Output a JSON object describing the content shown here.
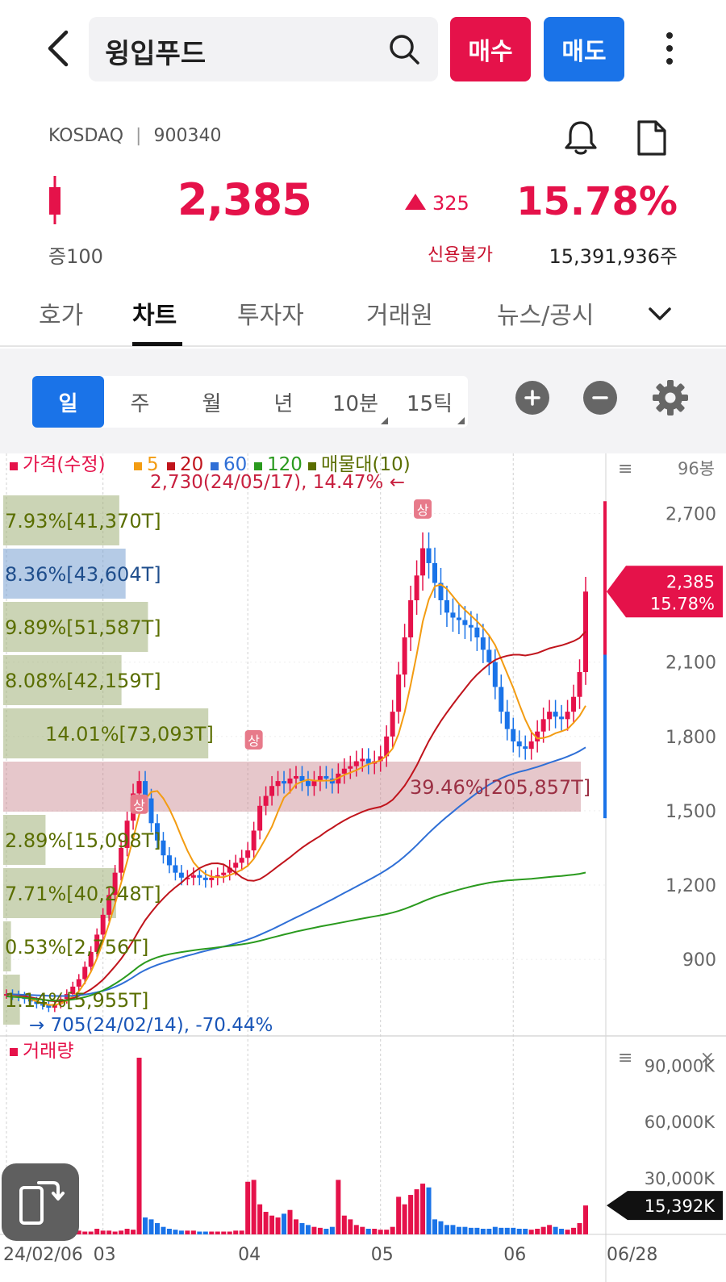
{
  "header": {
    "stock_name": "윙입푸드",
    "buy_label": "매수",
    "sell_label": "매도"
  },
  "info": {
    "market": "KOSDAQ",
    "code": "900340",
    "price": "2,385",
    "change": "325",
    "change_pct": "15.78%",
    "board": "증100",
    "credit": "신용불가",
    "shares": "15,391,936주"
  },
  "tabs": [
    {
      "label": "호가",
      "active": false
    },
    {
      "label": "차트",
      "active": true
    },
    {
      "label": "투자자",
      "active": false
    },
    {
      "label": "거래원",
      "active": false
    },
    {
      "label": "뉴스/공시",
      "active": false
    }
  ],
  "periods": [
    {
      "label": "일",
      "active": true
    },
    {
      "label": "주",
      "active": false
    },
    {
      "label": "월",
      "active": false
    },
    {
      "label": "년",
      "active": false
    },
    {
      "label": "10분",
      "active": false
    },
    {
      "label": "15틱",
      "active": false
    }
  ],
  "colors": {
    "up": "#e5124a",
    "down": "#1a73e8",
    "ma5": "#f39c12",
    "ma20": "#c0141c",
    "ma60": "#2f6fd6",
    "ma120": "#2a9a1e",
    "profile": "#5a6e00"
  },
  "chart_data": [
    {
      "type": "candlestick",
      "legend": [
        {
          "label": "가격(수정)",
          "color": "#e5124a"
        },
        {
          "label": "5",
          "color": "#f39c12"
        },
        {
          "label": "20",
          "color": "#c0141c"
        },
        {
          "label": "60",
          "color": "#2f6fd6"
        },
        {
          "label": "120",
          "color": "#2a9a1e"
        },
        {
          "label": "매물대(10)",
          "color": "#5a6e00"
        }
      ],
      "bar_count_label": "96봉",
      "y_ticks": [
        2700,
        2100,
        1800,
        1500,
        1200,
        900
      ],
      "y_tick_labels": [
        "2,700",
        "2,100",
        "1,800",
        "1,500",
        "1,200",
        "900"
      ],
      "ylim": [
        630,
        2780
      ],
      "x_labels": [
        "24/02/06",
        "03",
        "04",
        "05",
        "06",
        "06/28"
      ],
      "high_annotation": "2,730(24/05/17), 14.47%",
      "low_annotation": "705(24/02/14), -70.44%",
      "current_price_label": "2,385",
      "current_pct_label": "15.78%",
      "upper_limit_badge": "상",
      "volume_profile": [
        {
          "label": "7.93%[41,370T]",
          "pct": 7.93
        },
        {
          "label": "8.36%[43,604T]",
          "pct": 8.36
        },
        {
          "label": "9.89%[51,587T]",
          "pct": 9.89
        },
        {
          "label": "8.08%[42,159T]",
          "pct": 8.08
        },
        {
          "label": "14.01%[73,093T]",
          "pct": 14.01
        },
        {
          "label": "39.46%[205,857T]",
          "pct": 39.46
        },
        {
          "label": "2.89%[15,098T]",
          "pct": 2.89
        },
        {
          "label": "7.71%[40,248T]",
          "pct": 7.71
        },
        {
          "label": "0.53%[2,756T]",
          "pct": 0.53
        },
        {
          "label": "1.14%[5,955T]",
          "pct": 1.14
        }
      ],
      "closes": [
        760,
        755,
        750,
        740,
        730,
        720,
        715,
        705,
        720,
        740,
        760,
        790,
        820,
        870,
        930,
        1000,
        1080,
        1160,
        1250,
        1350,
        1460,
        1570,
        1620,
        1550,
        1450,
        1380,
        1320,
        1280,
        1250,
        1230,
        1230,
        1240,
        1230,
        1220,
        1230,
        1240,
        1250,
        1270,
        1290,
        1310,
        1340,
        1420,
        1520,
        1560,
        1600,
        1620,
        1610,
        1630,
        1640,
        1620,
        1600,
        1620,
        1640,
        1630,
        1610,
        1650,
        1670,
        1680,
        1700,
        1710,
        1690,
        1700,
        1720,
        1800,
        1900,
        2050,
        2200,
        2350,
        2450,
        2560,
        2500,
        2420,
        2350,
        2300,
        2280,
        2270,
        2250,
        2240,
        2200,
        2150,
        2100,
        2000,
        1900,
        1830,
        1780,
        1760,
        1750,
        1780,
        1820,
        1870,
        1900,
        1880,
        1870,
        1900,
        1960,
        2060,
        2385
      ],
      "ma_series": [
        {
          "name": "5",
          "values": [
            760,
            756,
            752,
            746,
            739,
            731,
            723,
            716,
            716,
            722,
            733,
            750,
            771,
            806,
            850,
            904,
            970,
            1044,
            1124,
            1208,
            1296,
            1388,
            1484,
            1546,
            1576,
            1580,
            1550,
            1508,
            1455,
            1395,
            1339,
            1292,
            1264,
            1244,
            1234,
            1232,
            1232,
            1240,
            1250,
            1262,
            1278,
            1306,
            1347,
            1390,
            1436,
            1497,
            1553,
            1576,
            1607,
            1618,
            1626,
            1622,
            1621,
            1622,
            1622,
            1632,
            1645,
            1654,
            1664,
            1676,
            1688,
            1696,
            1703,
            1723,
            1751,
            1810,
            1897,
            2009,
            2131,
            2264,
            2352,
            2406,
            2414,
            2396,
            2366,
            2336,
            2311,
            2288,
            2265,
            2239,
            2208,
            2169,
            2113,
            2054,
            1996,
            1930,
            1868,
            1818,
            1792,
            1794,
            1801,
            1813,
            1821,
            1830,
            1855,
            1883,
            1924
          ]
        },
        {
          "name": "20",
          "values": [
            760,
            758,
            755,
            752,
            747,
            742,
            738,
            733,
            731,
            732,
            736,
            743,
            752,
            765,
            779,
            797,
            818,
            844,
            872,
            902,
            937,
            976,
            1019,
            1058,
            1090,
            1120,
            1146,
            1170,
            1191,
            1210,
            1232,
            1251,
            1268,
            1280,
            1287,
            1288,
            1283,
            1268,
            1250,
            1231,
            1219,
            1217,
            1224,
            1239,
            1257,
            1276,
            1294,
            1312,
            1332,
            1351,
            1368,
            1383,
            1398,
            1416,
            1431,
            1447,
            1461,
            1474,
            1485,
            1496,
            1505,
            1511,
            1516,
            1527,
            1544,
            1571,
            1601,
            1640,
            1683,
            1733,
            1781,
            1823,
            1862,
            1897,
            1930,
            1962,
            1993,
            2024,
            2050,
            2072,
            2092,
            2109,
            2119,
            2126,
            2130,
            2130,
            2127,
            2131,
            2137,
            2146,
            2156,
            2162,
            2168,
            2176,
            2185,
            2198,
            2224
          ]
        },
        {
          "name": "60",
          "values": [
            760,
            759,
            758,
            757,
            756,
            755,
            754,
            753,
            752,
            752,
            752,
            753,
            755,
            758,
            762,
            767,
            773,
            780,
            789,
            800,
            813,
            828,
            844,
            857,
            868,
            878,
            886,
            894,
            901,
            908,
            915,
            921,
            928,
            934,
            940,
            946,
            952,
            958,
            965,
            972,
            980,
            989,
            999,
            1010,
            1021,
            1033,
            1045,
            1057,
            1069,
            1081,
            1093,
            1105,
            1117,
            1130,
            1142,
            1155,
            1168,
            1181,
            1194,
            1207,
            1220,
            1233,
            1247,
            1262,
            1278,
            1296,
            1316,
            1338,
            1361,
            1386,
            1410,
            1433,
            1455,
            1476,
            1496,
            1516,
            1535,
            1554,
            1572,
            1589,
            1605,
            1619,
            1631,
            1641,
            1650,
            1657,
            1663,
            1670,
            1677,
            1685,
            1694,
            1702,
            1710,
            1719,
            1729,
            1741,
            1756
          ]
        },
        {
          "name": "120",
          "values": [
            null,
            null,
            null,
            null,
            null,
            null,
            null,
            null,
            null,
            null,
            null,
            null,
            null,
            null,
            null,
            null,
            null,
            null,
            null,
            null,
            null,
            null,
            null,
            null,
            null,
            null,
            null,
            null,
            null,
            null,
            null,
            null,
            null,
            null,
            null,
            null,
            null,
            null,
            null,
            null,
            null,
            null,
            null,
            null,
            null,
            null,
            null,
            null,
            null,
            null,
            null,
            null,
            null,
            null,
            null,
            null,
            null,
            null,
            null,
            null,
            null,
            null,
            null,
            null,
            null,
            null,
            null,
            null,
            null,
            null,
            null,
            null,
            null,
            null,
            null,
            null,
            null,
            null,
            null,
            null,
            null,
            null,
            null,
            null,
            null,
            null,
            null,
            null,
            null,
            null,
            null,
            null,
            null,
            null,
            null,
            null,
            null
          ]
        }
      ]
    },
    {
      "type": "bar",
      "title": "거래량",
      "y_tick_labels": [
        "90,000K",
        "60,000K",
        "30,000K"
      ],
      "y_ticks": [
        90000,
        60000,
        30000
      ],
      "ylim": [
        0,
        100000
      ],
      "current_volume_label": "15,392K",
      "values": [
        500,
        400,
        400,
        400,
        350,
        300,
        300,
        300,
        500,
        800,
        1000,
        1500,
        2000,
        1500,
        1500,
        3000,
        2000,
        2000,
        1500,
        2000,
        3000,
        2500,
        94000,
        9000,
        8000,
        6000,
        4000,
        3000,
        2500,
        2000,
        2000,
        2000,
        1500,
        1500,
        1500,
        1500,
        1500,
        1500,
        2000,
        2000,
        28000,
        29000,
        16000,
        12000,
        10000,
        9000,
        11000,
        13000,
        8000,
        6000,
        5000,
        4000,
        3500,
        3000,
        4000,
        29000,
        10000,
        8000,
        5000,
        4000,
        3000,
        3000,
        2500,
        2500,
        4000,
        20000,
        16000,
        21000,
        24000,
        27000,
        25000,
        8000,
        7000,
        5000,
        5000,
        4000,
        4000,
        3500,
        3500,
        3000,
        3000,
        4000,
        3500,
        3500,
        3500,
        3000,
        3000,
        2500,
        3000,
        4000,
        5000,
        4000,
        3000,
        2500,
        3500,
        6000,
        15392
      ]
    }
  ]
}
